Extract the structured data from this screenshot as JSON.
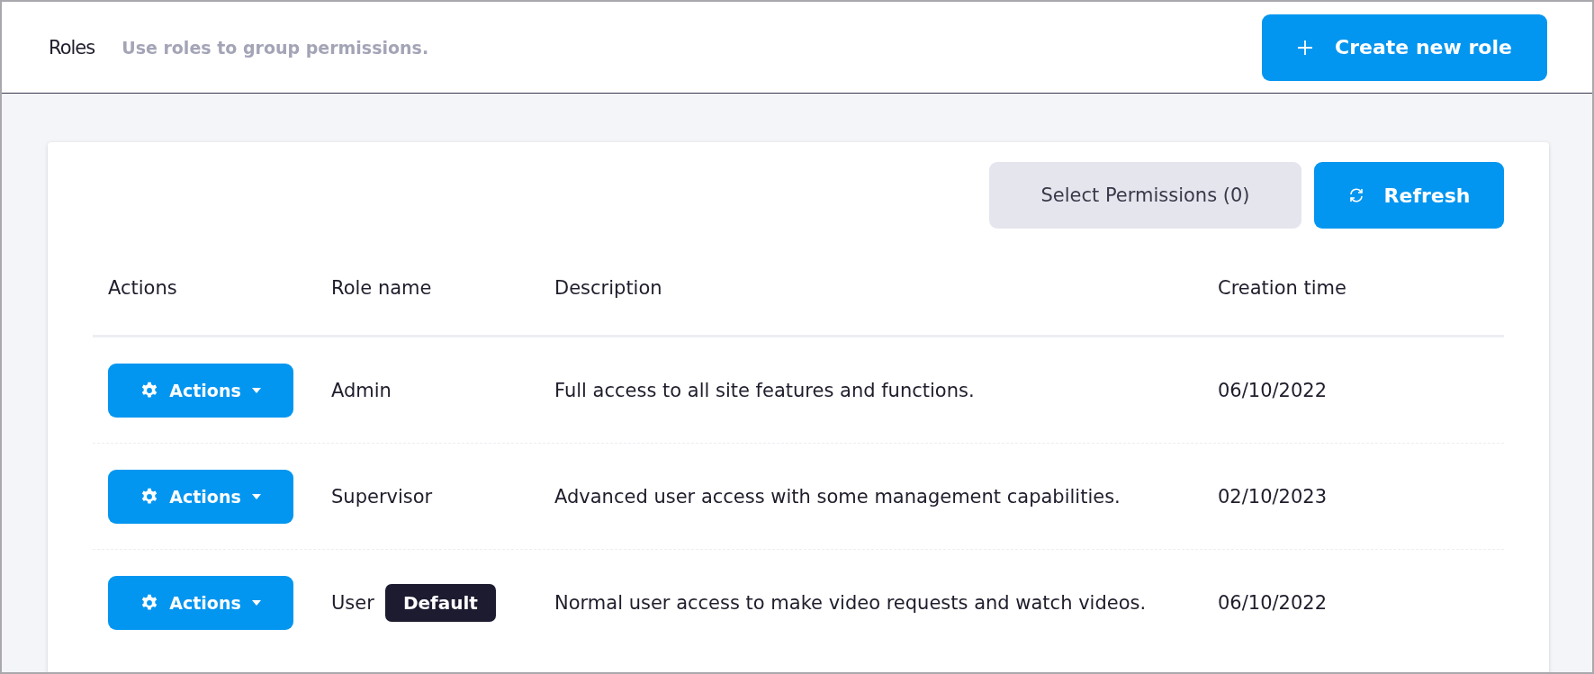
{
  "header": {
    "title": "Roles",
    "subtitle": "Use roles to group permissions.",
    "create_button": "Create new role"
  },
  "toolbar": {
    "select_button": "Select Permissions (0)",
    "refresh_button": "Refresh"
  },
  "table": {
    "columns": [
      "Actions",
      "Role name",
      "Description",
      "Creation time"
    ],
    "rows": [
      {
        "action": "Actions",
        "name": "Admin",
        "description": "Full access to all site features and functions.",
        "created": "06/10/2022"
      },
      {
        "action": "Actions",
        "name": "Supervisor",
        "description": "Advanced user access with some management capabilities.",
        "created": "02/10/2023"
      },
      {
        "action": "Actions",
        "name": "User",
        "badge": "Default",
        "description": "Normal user access to make video requests and watch videos.",
        "created": "06/10/2022"
      }
    ]
  }
}
